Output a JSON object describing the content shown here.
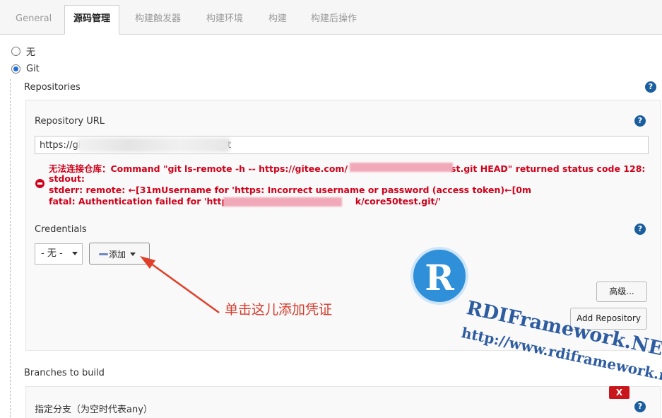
{
  "tabs": [
    {
      "label": "General",
      "active": false
    },
    {
      "label": "源码管理",
      "active": true
    },
    {
      "label": "构建触发器",
      "active": false
    },
    {
      "label": "构建环境",
      "active": false
    },
    {
      "label": "构建",
      "active": false
    },
    {
      "label": "构建后操作",
      "active": false
    }
  ],
  "scm_options": [
    {
      "label": "无",
      "selected": false
    },
    {
      "label": "Git",
      "selected": true
    }
  ],
  "repositories": {
    "section_label": "Repositories",
    "url_label": "Repository URL",
    "url_prefix": "https://gitee.cor",
    "url_suffix": "git",
    "error": {
      "line1_start": "无法连接仓库：Command \"git ls-remote -h -- https://gitee.com/",
      "line1_end": "st.git HEAD\" returned status code 128:",
      "line2": "stdout:",
      "line3": "stderr: remote: ←[31mUsername for 'https: Incorrect username or password (access token)←[0m",
      "line4_start": "fatal: Authentication failed for 'https:",
      "line4_end": "k/core50test.git/'"
    },
    "credentials_label": "Credentials",
    "credentials_value": "- 无 -",
    "add_button": "添加",
    "advanced_button": "高级...",
    "add_repository_button": "Add Repository"
  },
  "branches": {
    "section_label": "Branches to build",
    "branch_label": "指定分支（为空时代表any）",
    "delete_button": "X"
  },
  "annotation": "单击这儿添加凭证",
  "watermark": {
    "logo_letter": "R",
    "line1": "RDIFramework.NET",
    "line2": "http://www.rdiframework.net"
  },
  "help_glyph": "?"
}
